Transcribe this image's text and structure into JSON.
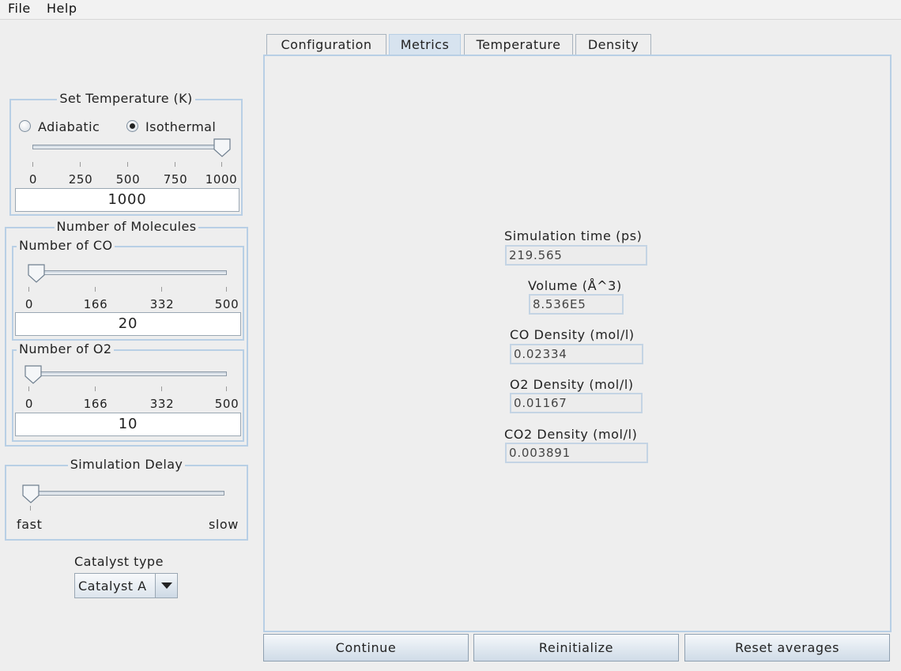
{
  "menu": {
    "file": "File",
    "help": "Help"
  },
  "tabs": [
    {
      "label": "Configuration",
      "active": false
    },
    {
      "label": "Metrics",
      "active": true
    },
    {
      "label": "Temperature",
      "active": false
    },
    {
      "label": "Density",
      "active": false
    }
  ],
  "temperature": {
    "title": "Set Temperature (K)",
    "adiabatic_label": "Adiabatic",
    "isothermal_label": "Isothermal",
    "selected_mode": "Isothermal",
    "ticks": [
      "0",
      "250",
      "500",
      "750",
      "1000"
    ],
    "slider_value": 1000,
    "slider_max": 1000,
    "value": "1000"
  },
  "molecules": {
    "title": "Number of Molecules",
    "co": {
      "title": "Number of CO",
      "ticks": [
        "0",
        "166",
        "332",
        "500"
      ],
      "slider_value": 20,
      "slider_max": 500,
      "value": "20"
    },
    "o2": {
      "title": "Number of O2",
      "ticks": [
        "0",
        "166",
        "332",
        "500"
      ],
      "slider_value": 10,
      "slider_max": 500,
      "value": "10"
    }
  },
  "delay": {
    "title": "Simulation Delay",
    "min_label": "fast",
    "max_label": "slow",
    "slider_fraction": 0.0
  },
  "catalyst": {
    "label": "Catalyst type",
    "selected": "Catalyst A"
  },
  "metrics": [
    {
      "label": "Simulation time (ps)",
      "value": "219.565"
    },
    {
      "label": "Volume (Å^3)",
      "value": "8.536E5"
    },
    {
      "label": "CO Density (mol/l)",
      "value": "0.02334"
    },
    {
      "label": "O2 Density (mol/l)",
      "value": "0.01167"
    },
    {
      "label": "CO2 Density (mol/l)",
      "value": "0.003891"
    }
  ],
  "buttons": {
    "continue": "Continue",
    "reinitialize": "Reinitialize",
    "reset": "Reset averages"
  },
  "colors": {
    "border_accent": "#b8cfe5",
    "active_tab": "#d7e3ef",
    "background": "#eeeeee"
  }
}
